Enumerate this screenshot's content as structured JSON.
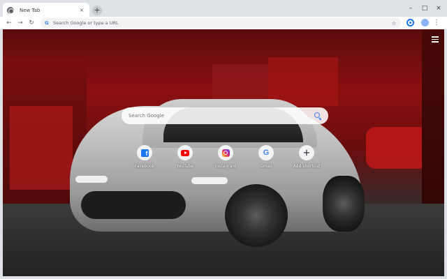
{
  "browser": {
    "tab": {
      "title": "New Tab",
      "close_glyph": "×",
      "favicon": "globe-icon"
    },
    "new_tab_glyph": "+",
    "window_controls": {
      "minimize": "–",
      "maximize": "□",
      "close": "×"
    },
    "toolbar": {
      "back_glyph": "←",
      "forward_glyph": "→",
      "reload_glyph": "↻",
      "omnibox_placeholder": "Search Google or type a URL",
      "omnibox_logo": "G",
      "star_glyph": "☆",
      "menu_glyph": "⋮"
    }
  },
  "newtab": {
    "search_placeholder": "Search Google",
    "background": "silver sports car in red-lit garage",
    "shortcuts": [
      {
        "label": "Facebook",
        "icon": "facebook-icon",
        "glyph": "f"
      },
      {
        "label": "YouTube",
        "icon": "youtube-icon",
        "glyph": ""
      },
      {
        "label": "Instagram",
        "icon": "instagram-icon",
        "glyph": ""
      },
      {
        "label": "Gmail",
        "icon": "google-icon",
        "glyph": "G"
      },
      {
        "label": "Add shortcut",
        "icon": "plus-icon",
        "glyph": "+"
      }
    ]
  },
  "colors": {
    "accent": "#1a73e8",
    "facebook": "#1877f2",
    "youtube": "#ff0000",
    "google_blue": "#4285f4"
  }
}
